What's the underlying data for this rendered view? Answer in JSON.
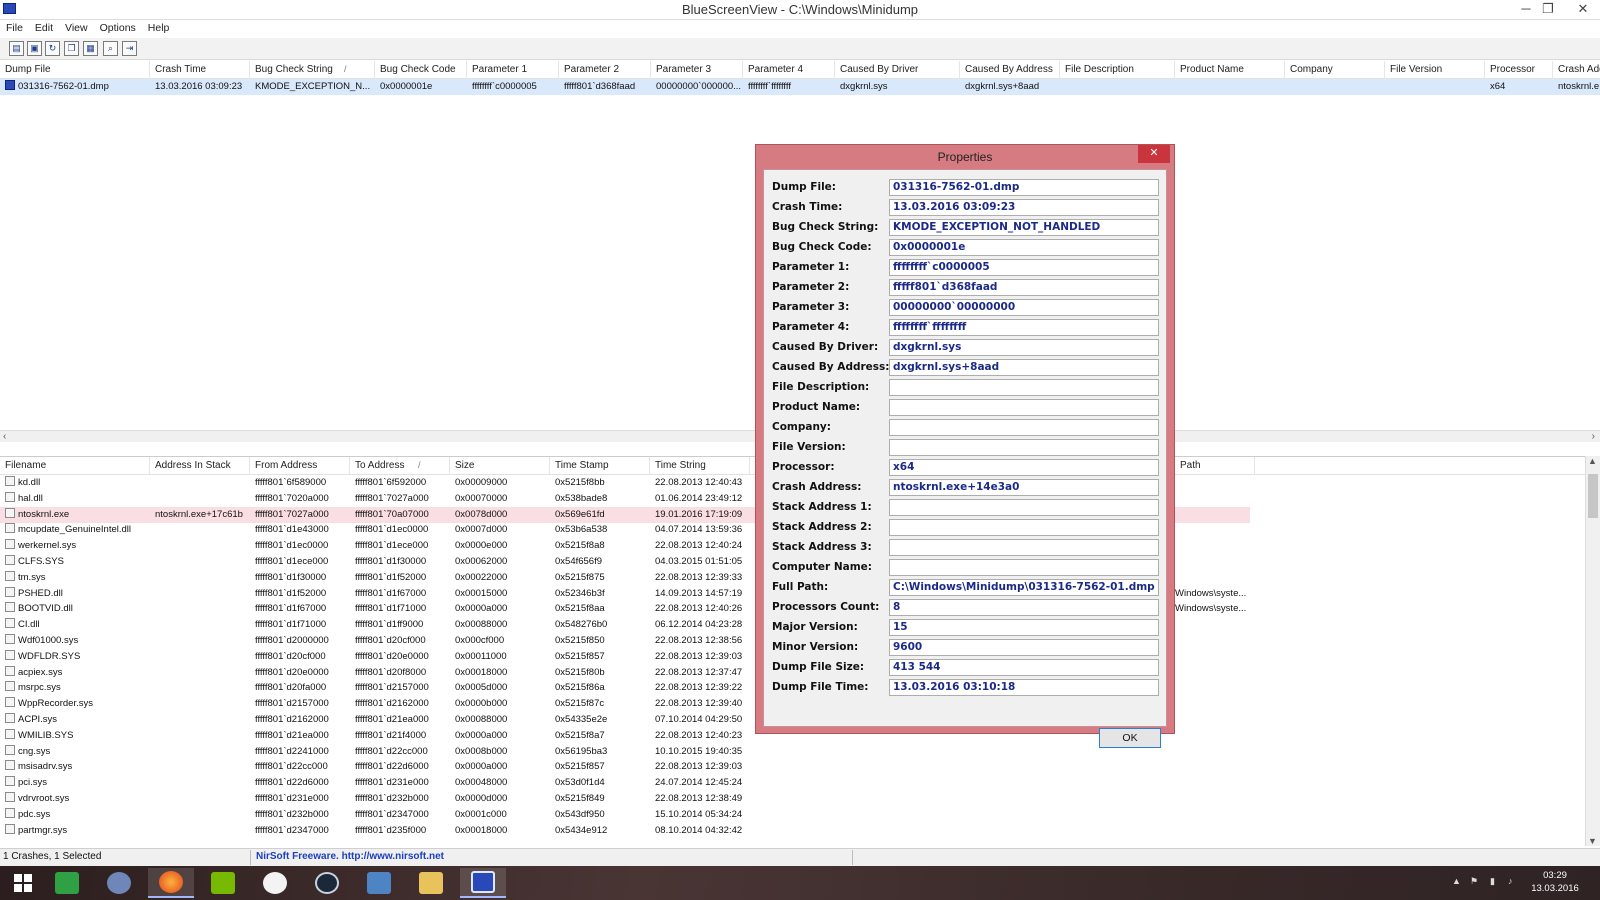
{
  "window": {
    "title": "BlueScreenView  -  C:\\Windows\\Minidump",
    "minimize": "─",
    "restore": "❐",
    "close": "✕"
  },
  "menu": [
    "File",
    "Edit",
    "View",
    "Options",
    "Help"
  ],
  "toolbar_icons": [
    "properties-icon",
    "save-icon",
    "refresh-icon",
    "copy-icon",
    "html-report-icon",
    "find-icon",
    "exit-icon"
  ],
  "upper_table": {
    "columns": [
      "Dump File",
      "Crash Time",
      "Bug Check String",
      "Bug Check Code",
      "Parameter 1",
      "Parameter 2",
      "Parameter 3",
      "Parameter 4",
      "Caused By Driver",
      "Caused By Address",
      "File Description",
      "Product Name",
      "Company",
      "File Version",
      "Processor",
      "Crash Address"
    ],
    "sort_mark": "/",
    "rows": [
      [
        "031316-7562-01.dmp",
        "13.03.2016 03:09:23",
        "KMODE_EXCEPTION_N...",
        "0x0000001e",
        "ffffffff`c0000005",
        "fffff801`d368faad",
        "00000000`000000...",
        "ffffffff`ffffffff",
        "dxgkrnl.sys",
        "dxgkrnl.sys+8aad",
        "",
        "",
        "",
        "",
        "x64",
        "ntoskrnl.e"
      ]
    ]
  },
  "lower_table": {
    "columns": [
      "Filename",
      "Address In Stack",
      "From Address",
      "To Address",
      "Size",
      "Time Stamp",
      "Time String"
    ],
    "path_column": "Path",
    "sort_mark": "/",
    "rows": [
      [
        "kd.dll",
        "",
        "fffff801`6f589000",
        "fffff801`6f592000",
        "0x00009000",
        "0x5215f8bb",
        "22.08.2013 12:40:43"
      ],
      [
        "hal.dll",
        "",
        "fffff801`7020a000",
        "fffff801`7027a000",
        "0x00070000",
        "0x538bade8",
        "01.06.2014 23:49:12"
      ],
      [
        "ntoskrnl.exe",
        "ntoskrnl.exe+17c61b",
        "fffff801`7027a000",
        "fffff801`70a07000",
        "0x0078d000",
        "0x569e61fd",
        "19.01.2016 17:19:09"
      ],
      [
        "mcupdate_GenuineIntel.dll",
        "",
        "fffff801`d1e43000",
        "fffff801`d1ec0000",
        "0x0007d000",
        "0x53b6a538",
        "04.07.2014 13:59:36"
      ],
      [
        "werkernel.sys",
        "",
        "fffff801`d1ec0000",
        "fffff801`d1ece000",
        "0x0000e000",
        "0x5215f8a8",
        "22.08.2013 12:40:24"
      ],
      [
        "CLFS.SYS",
        "",
        "fffff801`d1ece000",
        "fffff801`d1f30000",
        "0x00062000",
        "0x54f656f9",
        "04.03.2015 01:51:05"
      ],
      [
        "tm.sys",
        "",
        "fffff801`d1f30000",
        "fffff801`d1f52000",
        "0x00022000",
        "0x5215f875",
        "22.08.2013 12:39:33"
      ],
      [
        "PSHED.dll",
        "",
        "fffff801`d1f52000",
        "fffff801`d1f67000",
        "0x00015000",
        "0x52346b3f",
        "14.09.2013 14:57:19"
      ],
      [
        "BOOTVID.dll",
        "",
        "fffff801`d1f67000",
        "fffff801`d1f71000",
        "0x0000a000",
        "0x5215f8aa",
        "22.08.2013 12:40:26"
      ],
      [
        "CI.dll",
        "",
        "fffff801`d1f71000",
        "fffff801`d1ff9000",
        "0x00088000",
        "0x548276b0",
        "06.12.2014 04:23:28"
      ],
      [
        "Wdf01000.sys",
        "",
        "fffff801`d2000000",
        "fffff801`d20cf000",
        "0x000cf000",
        "0x5215f850",
        "22.08.2013 12:38:56"
      ],
      [
        "WDFLDR.SYS",
        "",
        "fffff801`d20cf000",
        "fffff801`d20e0000",
        "0x00011000",
        "0x5215f857",
        "22.08.2013 12:39:03"
      ],
      [
        "acpiex.sys",
        "",
        "fffff801`d20e0000",
        "fffff801`d20f8000",
        "0x00018000",
        "0x5215f80b",
        "22.08.2013 12:37:47"
      ],
      [
        "msrpc.sys",
        "",
        "fffff801`d20fa000",
        "fffff801`d2157000",
        "0x0005d000",
        "0x5215f86a",
        "22.08.2013 12:39:22"
      ],
      [
        "WppRecorder.sys",
        "",
        "fffff801`d2157000",
        "fffff801`d2162000",
        "0x0000b000",
        "0x5215f87c",
        "22.08.2013 12:39:40"
      ],
      [
        "ACPI.sys",
        "",
        "fffff801`d2162000",
        "fffff801`d21ea000",
        "0x00088000",
        "0x54335e2e",
        "07.10.2014 04:29:50"
      ],
      [
        "WMILIB.SYS",
        "",
        "fffff801`d21ea000",
        "fffff801`d21f4000",
        "0x0000a000",
        "0x5215f8a7",
        "22.08.2013 12:40:23"
      ],
      [
        "cng.sys",
        "",
        "fffff801`d2241000",
        "fffff801`d22cc000",
        "0x0008b000",
        "0x56195ba3",
        "10.10.2015 19:40:35"
      ],
      [
        "msisadrv.sys",
        "",
        "fffff801`d22cc000",
        "fffff801`d22d6000",
        "0x0000a000",
        "0x5215f857",
        "22.08.2013 12:39:03"
      ],
      [
        "pci.sys",
        "",
        "fffff801`d22d6000",
        "fffff801`d231e000",
        "0x00048000",
        "0x53d0f1d4",
        "24.07.2014 12:45:24"
      ],
      [
        "vdrvroot.sys",
        "",
        "fffff801`d231e000",
        "fffff801`d232b000",
        "0x0000d000",
        "0x5215f849",
        "22.08.2013 12:38:49"
      ],
      [
        "pdc.sys",
        "",
        "fffff801`d232b000",
        "fffff801`d2347000",
        "0x0001c000",
        "0x543df950",
        "15.10.2014 05:34:24"
      ],
      [
        "partmgr.sys",
        "",
        "fffff801`d2347000",
        "fffff801`d235f000",
        "0x00018000",
        "0x5434e912",
        "08.10.2014 04:32:42"
      ]
    ],
    "path_fragments": [
      "Windows\\syste...",
      "Windows\\syste..."
    ]
  },
  "properties_dialog": {
    "title": "Properties",
    "close": "✕",
    "ok": "OK",
    "fields": [
      {
        "label": "Dump File:",
        "value": "031316-7562-01.dmp"
      },
      {
        "label": "Crash Time:",
        "value": "13.03.2016 03:09:23"
      },
      {
        "label": "Bug Check String:",
        "value": "KMODE_EXCEPTION_NOT_HANDLED"
      },
      {
        "label": "Bug Check Code:",
        "value": "0x0000001e"
      },
      {
        "label": "Parameter 1:",
        "value": "ffffffff`c0000005"
      },
      {
        "label": "Parameter 2:",
        "value": "fffff801`d368faad"
      },
      {
        "label": "Parameter 3:",
        "value": "00000000`00000000"
      },
      {
        "label": "Parameter 4:",
        "value": "ffffffff`ffffffff"
      },
      {
        "label": "Caused By Driver:",
        "value": "dxgkrnl.sys"
      },
      {
        "label": "Caused By Address:",
        "value": "dxgkrnl.sys+8aad"
      },
      {
        "label": "File Description:",
        "value": ""
      },
      {
        "label": "Product Name:",
        "value": ""
      },
      {
        "label": "Company:",
        "value": ""
      },
      {
        "label": "File Version:",
        "value": ""
      },
      {
        "label": "Processor:",
        "value": "x64"
      },
      {
        "label": "Crash Address:",
        "value": "ntoskrnl.exe+14e3a0"
      },
      {
        "label": "Stack Address 1:",
        "value": ""
      },
      {
        "label": "Stack Address 2:",
        "value": ""
      },
      {
        "label": "Stack Address 3:",
        "value": ""
      },
      {
        "label": "Computer Name:",
        "value": ""
      },
      {
        "label": "Full Path:",
        "value": "C:\\Windows\\Minidump\\031316-7562-01.dmp"
      },
      {
        "label": "Processors Count:",
        "value": "8"
      },
      {
        "label": "Major Version:",
        "value": "15"
      },
      {
        "label": "Minor Version:",
        "value": "9600"
      },
      {
        "label": "Dump File Size:",
        "value": "413 544"
      },
      {
        "label": "Dump File Time:",
        "value": "13.03.2016 03:10:18"
      }
    ]
  },
  "status": {
    "left": "1 Crashes, 1 Selected",
    "link": "NirSoft Freeware.  http://www.nirsoft.net"
  },
  "taskbar": {
    "apps": [
      "windows-start-icon",
      "store-icon",
      "user-app-icon",
      "firefox-icon",
      "nvidia-icon",
      "itunes-icon",
      "steam-icon",
      "monitor-app-icon",
      "file-explorer-icon",
      "bluescreenview-icon"
    ],
    "clock": {
      "time": "03:29",
      "date": "13.03.2016"
    }
  },
  "colors": {
    "dialog_frame": "#d67b82",
    "value_text": "#1b2a87",
    "highlight_row": "#f9dfe4",
    "link": "#1b3fc0"
  }
}
